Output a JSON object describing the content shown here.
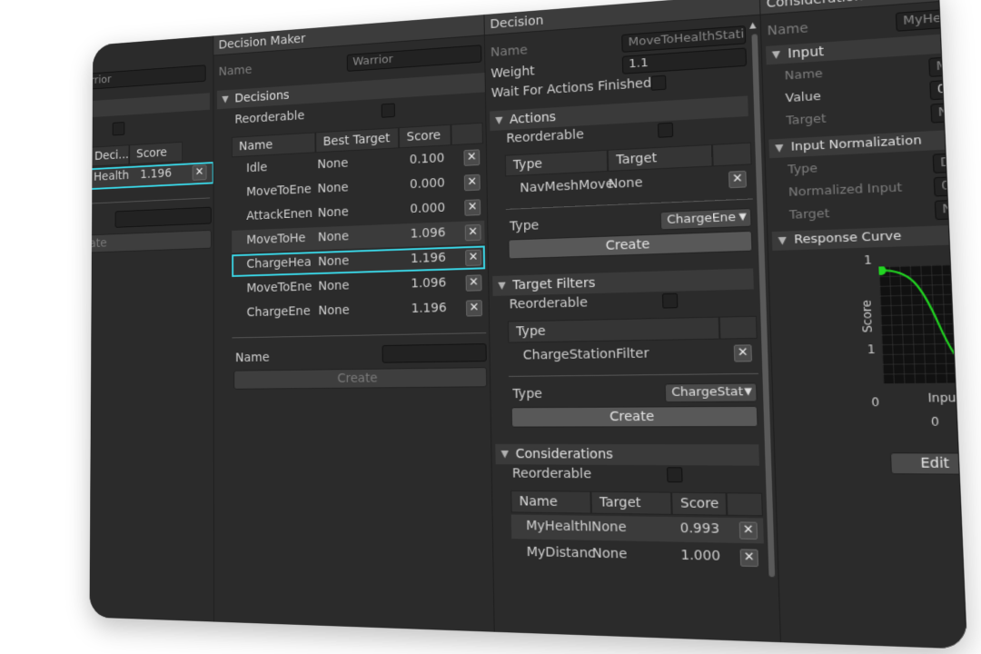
{
  "left_panel": {
    "name_value": "Warrior",
    "col_decision": "Deci...",
    "col_score": "Score",
    "row_name": "Health",
    "row_score": "1.196",
    "create_label": "ate"
  },
  "decision_maker": {
    "title": "Decision Maker",
    "name_label": "Name",
    "name_value": "Warrior",
    "section": "Decisions",
    "reorderable": "Reorderable",
    "col_name": "Name",
    "col_target": "Best Target",
    "col_score": "Score",
    "rows": [
      {
        "name": "Idle",
        "target": "None",
        "score": "0.100"
      },
      {
        "name": "MoveToEne",
        "target": "None",
        "score": "0.000"
      },
      {
        "name": "AttackEnen",
        "target": "None",
        "score": "0.000"
      },
      {
        "name": "MoveToHe",
        "target": "None",
        "score": "1.096"
      },
      {
        "name": "ChargeHea",
        "target": "None",
        "score": "1.196"
      },
      {
        "name": "MoveToEne",
        "target": "None",
        "score": "1.096"
      },
      {
        "name": "ChargeEne",
        "target": "None",
        "score": "1.196"
      }
    ],
    "footer_name_label": "Name",
    "create_label": "Create"
  },
  "decision": {
    "title": "Decision",
    "name_label": "Name",
    "name_value": "MoveToHealthStati",
    "weight_label": "Weight",
    "weight_value": "1.1",
    "wait_label": "Wait For Actions Finished",
    "actions_section": "Actions",
    "reorderable": "Reorderable",
    "col_type": "Type",
    "col_target": "Target",
    "action_row": {
      "type": "NavMeshMove",
      "target": "None"
    },
    "type_label": "Type",
    "action_type_dropdown": "ChargeEne",
    "create_label": "Create",
    "filters_section": "Target Filters",
    "filter_row": "ChargeStationFilter",
    "filter_type_dropdown": "ChargeStat",
    "considerations_section": "Considerations",
    "col_name": "Name",
    "col_score": "Score",
    "consideration_rows": [
      {
        "name": "MyHealthI",
        "target": "None",
        "score": "0.993"
      },
      {
        "name": "MyDistanc",
        "target": "None",
        "score": "1.000"
      }
    ]
  },
  "consideration": {
    "title": "Consideration",
    "name_label": "Name",
    "name_value": "MyHea",
    "input_section": "Input",
    "input_name_label": "Name",
    "input_name_value": "M",
    "value_label": "Value",
    "value_value": "0",
    "target_label": "Target",
    "target_value": "N",
    "normalization_section": "Input Normalization",
    "type_label": "Type",
    "type_value": "D",
    "normalized_label": "Normalized Input",
    "normalized_value": "0",
    "norm_target_label": "Target",
    "norm_target_value": "N",
    "curve_section": "Response Curve",
    "y_top": "1",
    "y_mid": "1",
    "y_bottom": "0",
    "y_axis_label": "Score",
    "x_axis_label": "Input",
    "x_start": "0",
    "edit_label": "Edit",
    "curve_color": "#22d622"
  }
}
